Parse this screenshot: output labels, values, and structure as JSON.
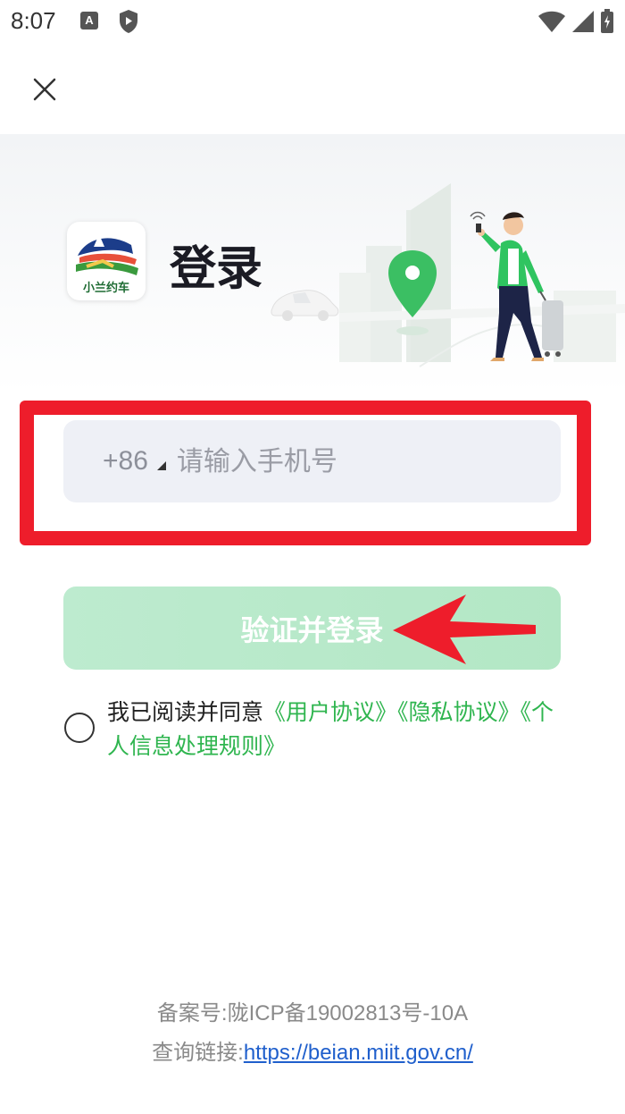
{
  "status_bar": {
    "time": "8:07",
    "notification_letter": "A",
    "icons": [
      "a-notification-icon",
      "shield-icon",
      "wifi-icon",
      "signal-icon",
      "battery-icon"
    ]
  },
  "header": {
    "close_icon": "close-icon",
    "title": "登录",
    "logo_text": "小兰约车"
  },
  "phone": {
    "country_code": "+86",
    "placeholder": "请输入手机号",
    "value": ""
  },
  "login_button": {
    "label": "验证并登录"
  },
  "agreement": {
    "prefix": "我已阅读并同意",
    "links": [
      "《用户协议》",
      "《隐私协议》",
      "《个人信息处理规则》"
    ]
  },
  "footer": {
    "icp": "备案号:陇ICP备19002813号-10A",
    "query_label": "查询链接:",
    "query_url": "https://beian.miit.gov.cn/"
  },
  "colors": {
    "accent_green": "#2fb54f",
    "button_bg": "#bdebcf",
    "highlight_red": "#ee1d2b",
    "link_blue": "#1f5fcc"
  }
}
